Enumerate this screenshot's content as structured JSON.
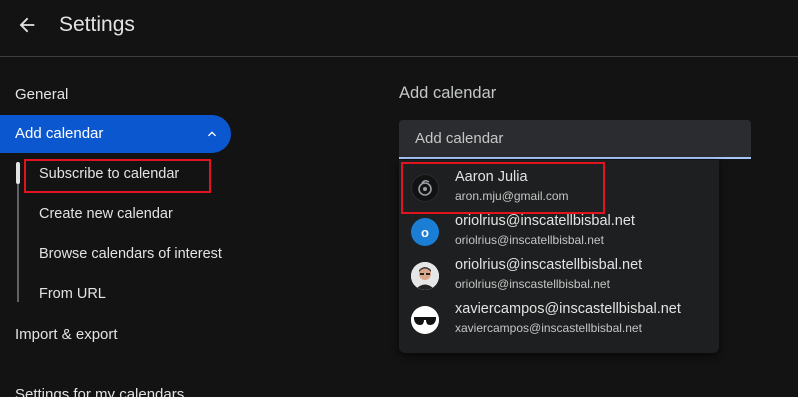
{
  "header": {
    "title": "Settings"
  },
  "sidebar": {
    "general": "General",
    "add_calendar": "Add calendar",
    "sub_items": [
      {
        "label": "Subscribe to calendar"
      },
      {
        "label": "Create new calendar"
      },
      {
        "label": "Browse calendars of interest"
      },
      {
        "label": "From URL"
      }
    ],
    "import_export": "Import & export",
    "settings_my_calendars": "Settings for my calendars"
  },
  "main": {
    "section_title": "Add calendar",
    "input_placeholder": "Add calendar"
  },
  "suggestions": [
    {
      "name": "Aaron Julia",
      "email": "aron.mju@gmail.com",
      "avatar": "dark-logo-avatar"
    },
    {
      "name": "oriolrius@inscatellbisbal.net",
      "email": "oriolrius@inscatellbisbal.net",
      "avatar": "letter-o-avatar",
      "letter": "o"
    },
    {
      "name": "oriolrius@inscastellbisbal.net",
      "email": "oriolrius@inscastellbisbal.net",
      "avatar": "photo-avatar"
    },
    {
      "name": "xaviercampos@inscastellbisbal.net",
      "email": "xaviercampos@inscastellbisbal.net",
      "avatar": "sunglasses-avatar"
    }
  ],
  "colors": {
    "accent": "#0b57d0",
    "highlight_box": "#e0141e",
    "background": "#131314",
    "avatar_o": "#1a7fd4"
  }
}
